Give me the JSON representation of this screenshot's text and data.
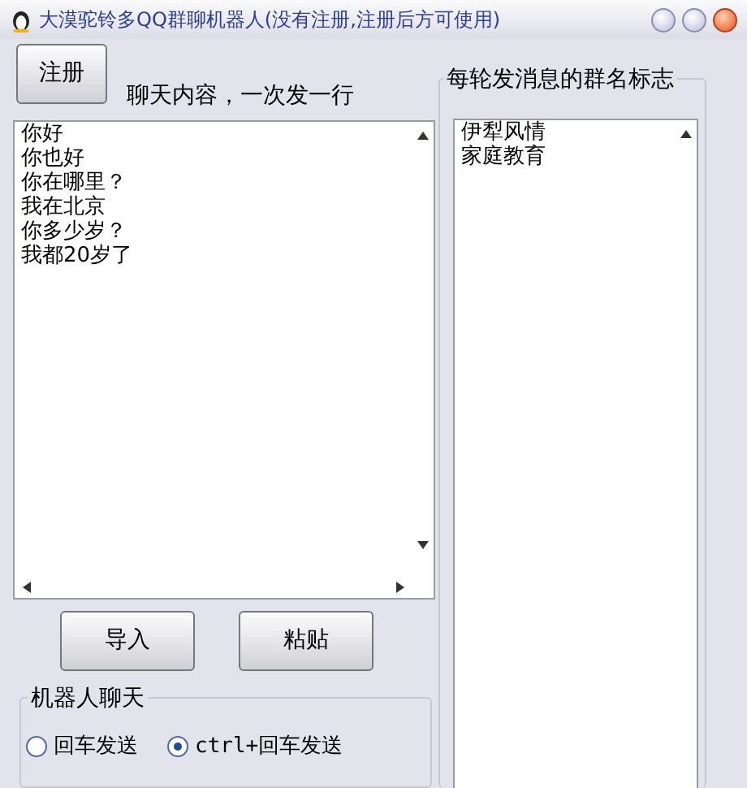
{
  "window": {
    "title": "大漠驼铃多QQ群聊机器人(没有注册,注册后方可使用)"
  },
  "register_button": "注册",
  "chat_label": "聊天内容，一次发一行",
  "chat_lines": [
    "你好",
    "你也好",
    "你在哪里？",
    "我在北京",
    "你多少岁？",
    "我都20岁了"
  ],
  "buttons": [
    "导入",
    "粘贴"
  ],
  "robot_group": {
    "title": "机器人聊天",
    "options": [
      {
        "label": "回车发送",
        "selected": false
      },
      {
        "label": "ctrl+回车发送",
        "selected": true
      }
    ]
  },
  "group_names": {
    "title": "每轮发消息的群名标志",
    "lines": [
      "伊犁风情",
      "家庭教育"
    ]
  }
}
